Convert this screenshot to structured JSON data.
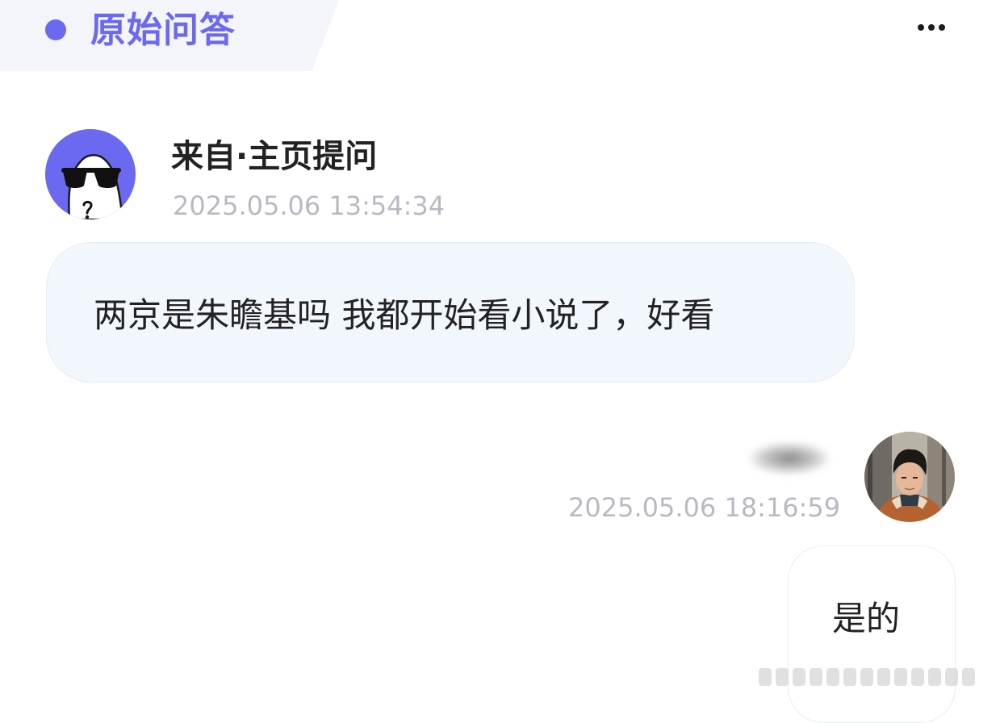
{
  "header": {
    "title": "原始问答",
    "accent_color": "#6b69f0",
    "more_icon": "more-horizontal-icon"
  },
  "question": {
    "asker_name": "来自·主页提问",
    "timestamp": "2025.05.06 13:54:34",
    "text": "两京是朱瞻基吗 我都开始看小说了，好看",
    "avatar_icon": "anonymous-sunglasses-avatar"
  },
  "answer": {
    "timestamp": "2025.05.06 18:16:59",
    "text": "是的",
    "avatar_icon": "user-photo-avatar"
  },
  "colors": {
    "question_bubble_bg": "#f2f6fd",
    "timestamp_color": "#b8bac2",
    "text_color": "#222222"
  }
}
